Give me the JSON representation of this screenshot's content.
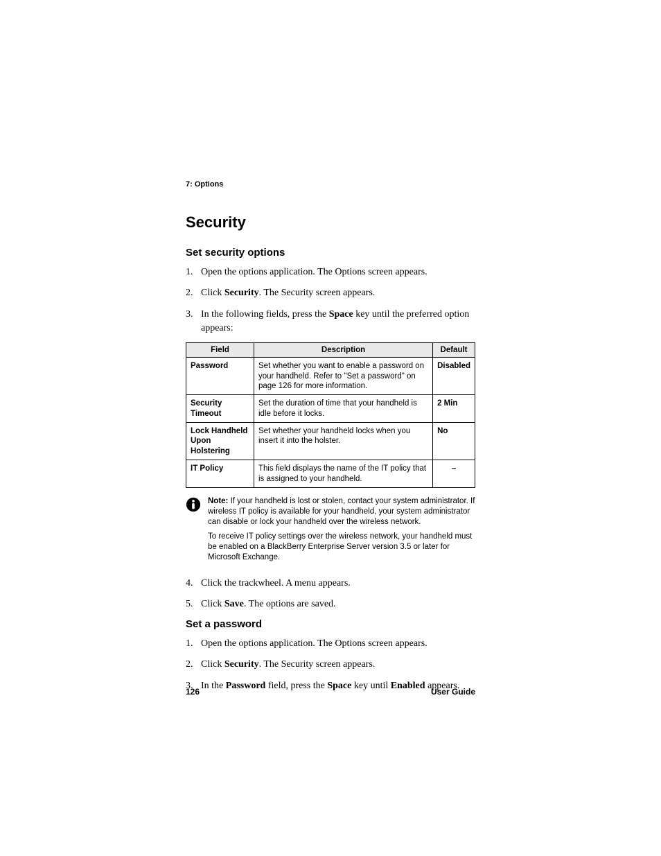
{
  "chapter": "7: Options",
  "section_title": "Security",
  "sub_a": {
    "title": "Set security options",
    "steps": [
      {
        "text": "Open the options application. The Options screen appears."
      },
      {
        "pre": "Click ",
        "bold": "Security",
        "post": ". The Security screen appears."
      },
      {
        "pre": "In the following fields, press the ",
        "bold": "Space",
        "post": " key until the preferred option appears:"
      }
    ],
    "steps_after": [
      {
        "text": "Click the trackwheel. A menu appears."
      },
      {
        "pre": "Click ",
        "bold": "Save",
        "post": ". The options are saved."
      }
    ]
  },
  "table": {
    "headers": {
      "field": "Field",
      "description": "Description",
      "default": "Default"
    },
    "rows": [
      {
        "field": "Password",
        "desc": "Set whether you want to enable a password on your handheld. Refer to \"Set a password\" on page 126 for more information.",
        "default": "Disabled"
      },
      {
        "field": "Security Timeout",
        "desc": "Set the duration of time that your handheld is idle before it locks.",
        "default": "2 Min"
      },
      {
        "field": "Lock Handheld Upon Holstering",
        "desc": "Set whether your handheld locks when you insert it into the holster.",
        "default": "No"
      },
      {
        "field": "IT Policy",
        "desc": "This field displays the name of the IT policy that is assigned to your handheld.",
        "default": "–"
      }
    ]
  },
  "note": {
    "label": "Note:",
    "p1_post": " If your handheld is lost or stolen, contact your system administrator. If wireless IT policy is available for your handheld, your system administrator can disable or lock your handheld over the wireless network.",
    "p2": "To receive IT policy settings over the wireless network, your handheld must be enabled on a BlackBerry Enterprise Server version 3.5 or later for Microsoft Exchange."
  },
  "sub_b": {
    "title": "Set a password",
    "steps": [
      {
        "text": "Open the options application. The Options screen appears."
      },
      {
        "pre": "Click ",
        "bold": "Security",
        "post": ". The Security screen appears."
      },
      {
        "pre": "In the ",
        "bold": "Password",
        "mid": " field, press the ",
        "bold2": "Space",
        "mid2": " key until ",
        "bold3": "Enabled",
        "post": " appears."
      }
    ]
  },
  "footer": {
    "page": "126",
    "label": "User Guide"
  }
}
